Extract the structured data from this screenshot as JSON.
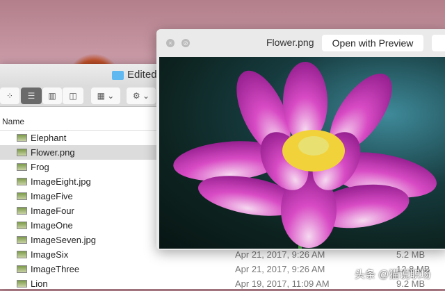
{
  "finder": {
    "folder_title": "Edited",
    "column_header": "Name",
    "rows": [
      {
        "name": "Elephant",
        "date": "",
        "size": ""
      },
      {
        "name": "Flower.png",
        "date": "",
        "size": "",
        "selected": true
      },
      {
        "name": "Frog",
        "date": "",
        "size": ""
      },
      {
        "name": "ImageEight.jpg",
        "date": "",
        "size": ""
      },
      {
        "name": "ImageFive",
        "date": "",
        "size": ""
      },
      {
        "name": "ImageFour",
        "date": "",
        "size": ""
      },
      {
        "name": "ImageOne",
        "date": "",
        "size": ""
      },
      {
        "name": "ImageSeven.jpg",
        "date": "",
        "size": ""
      },
      {
        "name": "ImageSix",
        "date": "Apr 21, 2017, 9:26 AM",
        "size": "5.2 MB"
      },
      {
        "name": "ImageThree",
        "date": "Apr 21, 2017, 9:26 AM",
        "size": "12.8 MB"
      },
      {
        "name": "Lion",
        "date": "Apr 19, 2017, 11:09 AM",
        "size": "9.2 MB"
      }
    ]
  },
  "quicklook": {
    "title": "Flower.png",
    "open_button": "Open with Preview"
  },
  "watermark": "头条 @猫说职场"
}
